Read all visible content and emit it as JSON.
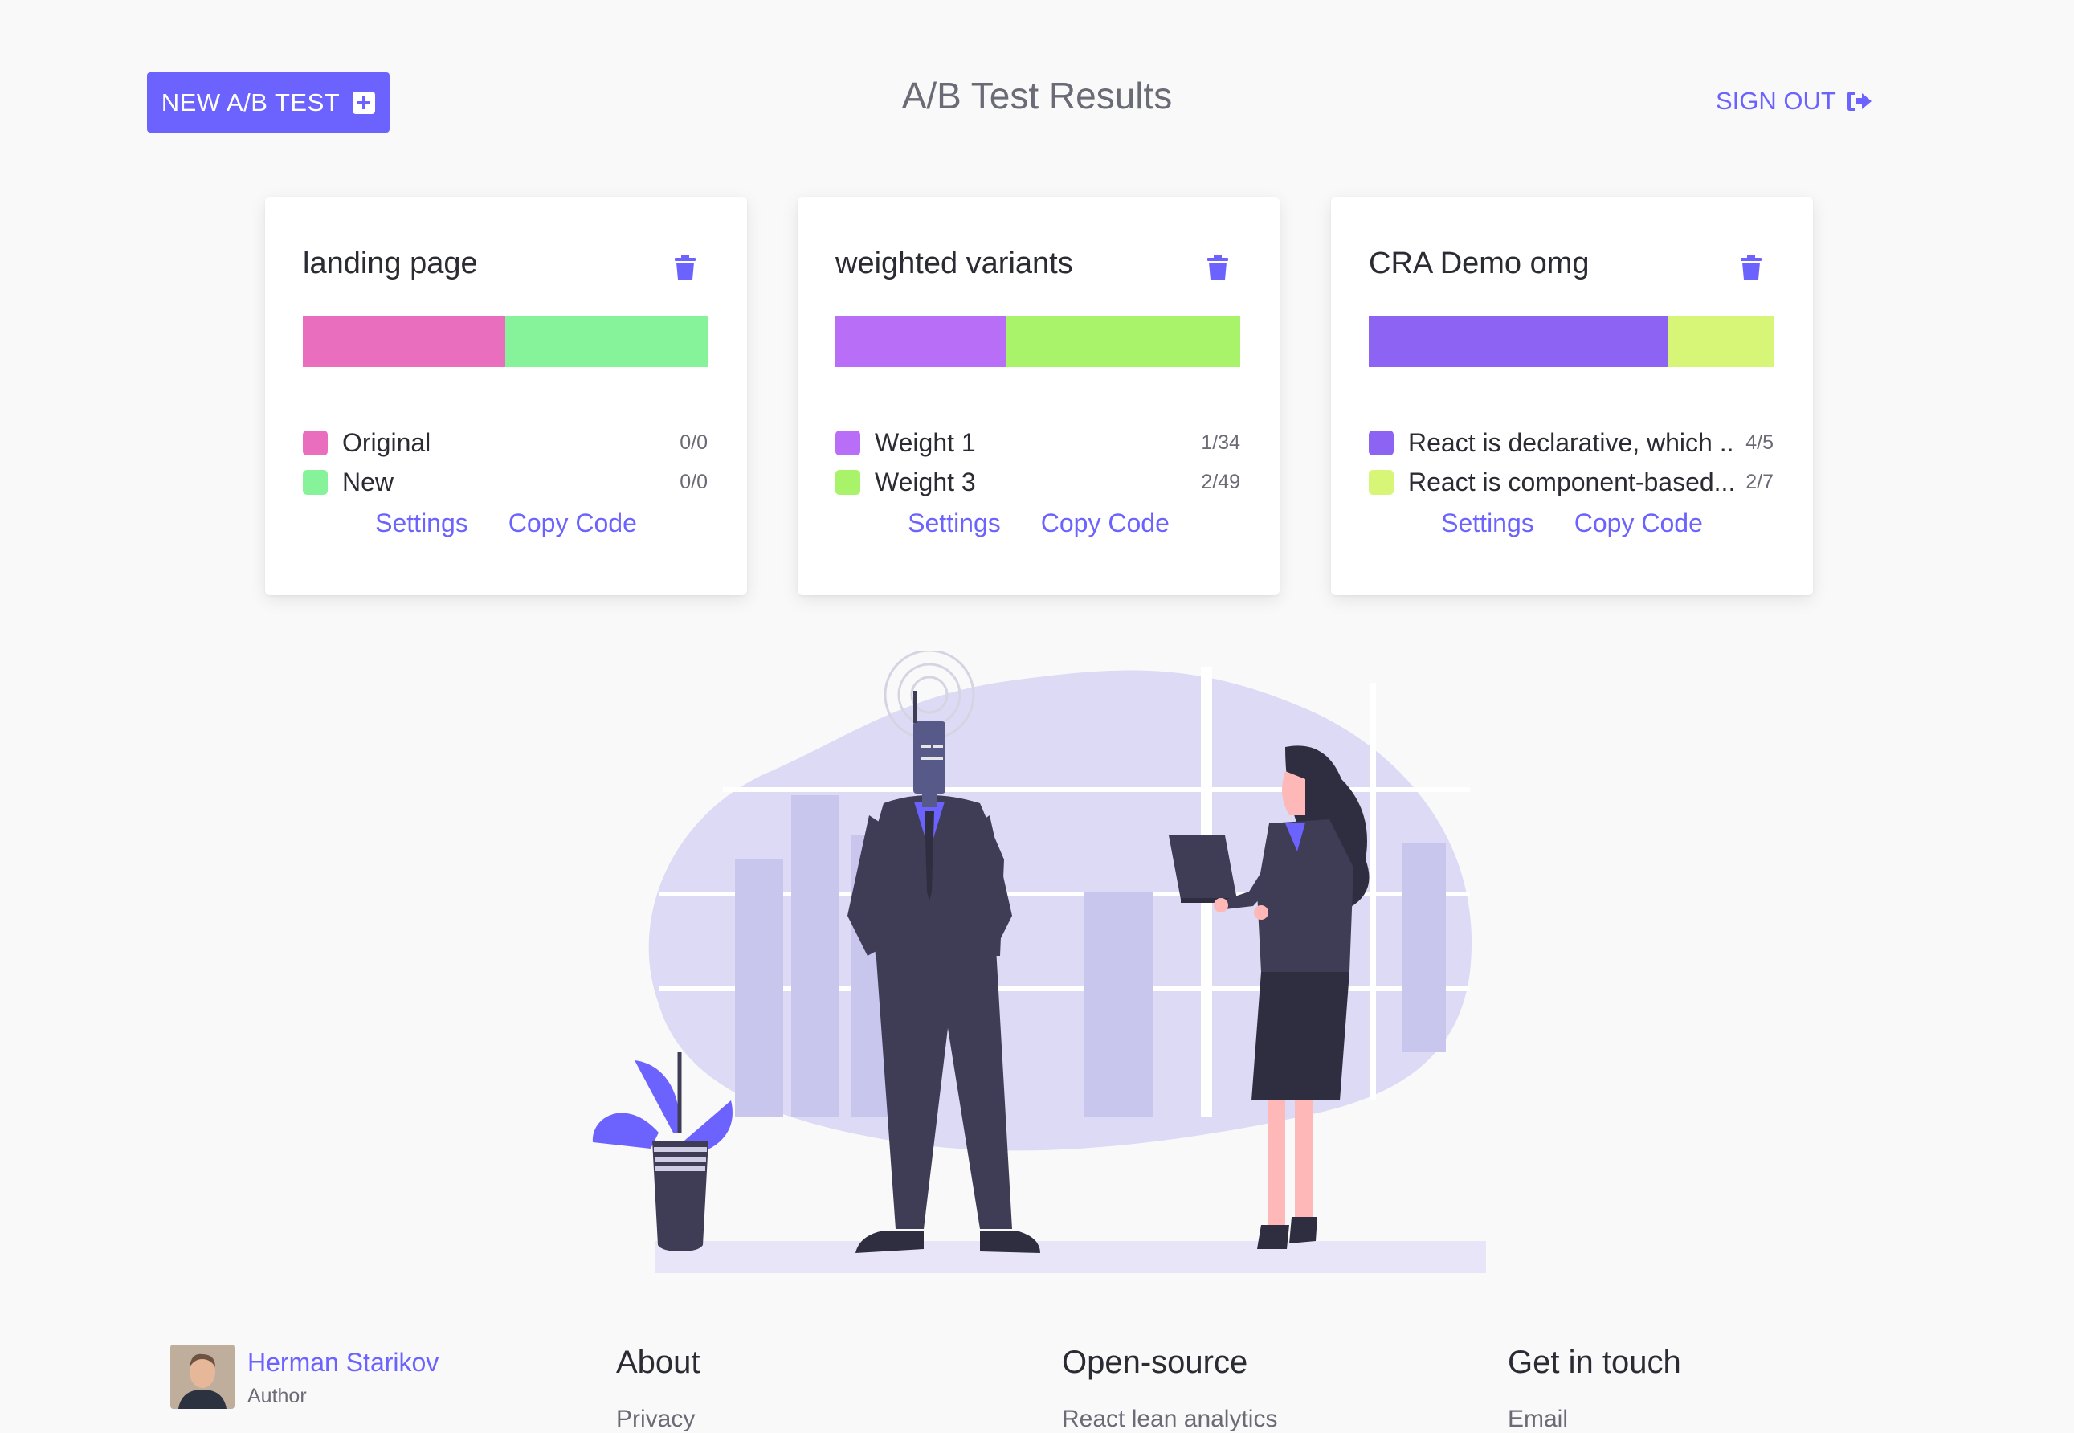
{
  "header": {
    "new_test_label": "NEW A/B TEST",
    "title": "A/B Test Results",
    "sign_out_label": "SIGN OUT"
  },
  "colors": {
    "accent": "#6c63ff",
    "background": "#f9f9fa"
  },
  "cards": [
    {
      "title": "landing page",
      "variants": [
        {
          "name": "Original",
          "count": "0/0",
          "color": "#e96ebd",
          "share": 0.5
        },
        {
          "name": "New",
          "count": "0/0",
          "color": "#86f39a",
          "share": 0.5
        }
      ],
      "settings_label": "Settings",
      "copy_label": "Copy Code"
    },
    {
      "title": "weighted variants",
      "variants": [
        {
          "name": "Weight 1",
          "count": "1/34",
          "color": "#b86ef7",
          "share": 0.42
        },
        {
          "name": "Weight 3",
          "count": "2/49",
          "color": "#a8f36a",
          "share": 0.58
        }
      ],
      "settings_label": "Settings",
      "copy_label": "Copy Code"
    },
    {
      "title": "CRA Demo omg",
      "variants": [
        {
          "name": "React is declarative, which ...",
          "count": "4/5",
          "color": "#8d63f3",
          "share": 0.74
        },
        {
          "name": "React is component-based....",
          "count": "2/7",
          "color": "#d7f576",
          "share": 0.26
        }
      ],
      "settings_label": "Settings",
      "copy_label": "Copy Code"
    }
  ],
  "footer": {
    "author": {
      "name": "Herman Starikov",
      "role": "Author"
    },
    "columns": [
      {
        "heading": "About",
        "first_link": "Privacy"
      },
      {
        "heading": "Open-source",
        "first_link": "React lean analytics"
      },
      {
        "heading": "Get in touch",
        "first_link": "Email"
      }
    ]
  }
}
